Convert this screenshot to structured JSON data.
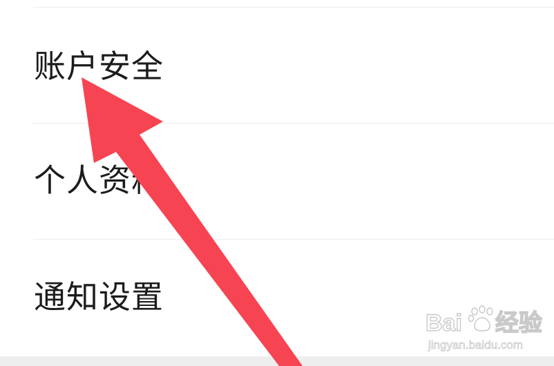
{
  "settings_list": {
    "items": [
      {
        "label": "账户安全"
      },
      {
        "label": "个人资料"
      },
      {
        "label": "通知设置"
      }
    ]
  },
  "annotation": {
    "arrow_color": "#f74452",
    "icon": "red-arrow-annotation"
  },
  "watermark": {
    "logo_left": "Bai",
    "logo_right": "经验",
    "url": "jingyan.baidu.com"
  }
}
